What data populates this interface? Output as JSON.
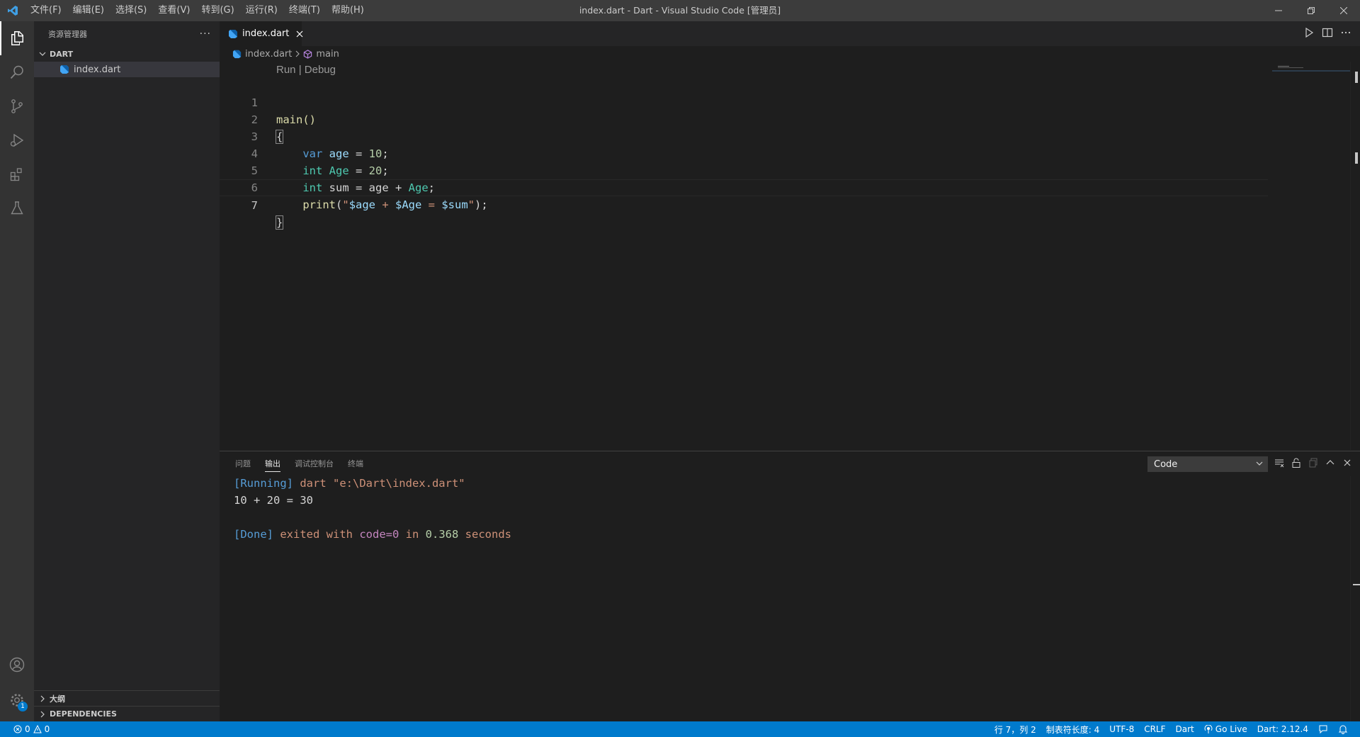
{
  "titlebar": {
    "title": "index.dart - Dart - Visual Studio Code [管理员]",
    "menu": [
      "文件(F)",
      "编辑(E)",
      "选择(S)",
      "查看(V)",
      "转到(G)",
      "运行(R)",
      "终端(T)",
      "帮助(H)"
    ]
  },
  "activity": {
    "badge": "1"
  },
  "sidebar": {
    "title": "资源管理器",
    "more": "···",
    "folder": "DART",
    "file": "index.dart",
    "outline": "大纲",
    "dependencies": "DEPENDENCIES"
  },
  "editor": {
    "tab_label": "index.dart",
    "breadcrumb_file": "index.dart",
    "breadcrumb_symbol": "main",
    "codelens_run": "Run",
    "codelens_sep": " | ",
    "codelens_debug": "Debug",
    "line_numbers": [
      "1",
      "2",
      "3",
      "4",
      "5",
      "6",
      "7"
    ],
    "code": {
      "l1_fn": "main()",
      "l2": "{",
      "l3_kw": "var",
      "l3_var": " age",
      "l3_op": " = ",
      "l3_num": "10",
      "l3_end": ";",
      "l4_type": "int",
      "l4_var": " Age",
      "l4_op": " = ",
      "l4_num": "20",
      "l4_end": ";",
      "l5_type": "int",
      "l5_var": " sum",
      "l5_op": " = age + ",
      "l5_var2": "Age",
      "l5_end": ";",
      "l6_fn": "print",
      "l6_open": "(",
      "l6_q1": "\"",
      "l6_i1": "$age",
      "l6_s1": " + ",
      "l6_i2": "$Age",
      "l6_s2": " = ",
      "l6_i3": "$sum",
      "l6_q2": "\"",
      "l6_close": ");",
      "l7": "}"
    }
  },
  "panel": {
    "tabs": [
      "问题",
      "输出",
      "调试控制台",
      "终端"
    ],
    "active_tab": "输出",
    "channel": "Code",
    "output": {
      "running": "[Running]",
      "cmd": " dart \"e:\\Dart\\index.dart\"",
      "result": "10 + 20 = 30",
      "done": "[Done]",
      "exited": " exited with ",
      "code": "code=0",
      "in": " in ",
      "secs": "0.368",
      "seconds": " seconds"
    }
  },
  "statusbar": {
    "errors": "0",
    "warnings": "0",
    "position": "行 7，列 2",
    "indent": "制表符长度: 4",
    "encoding": "UTF-8",
    "eol": "CRLF",
    "language": "Dart",
    "golive": "Go Live",
    "sdk": "Dart: 2.12.4"
  },
  "colors": {
    "accent": "#007acc",
    "keyword": "#569cd6",
    "type": "#4ec9b0",
    "string": "#ce9178",
    "number": "#b5cea8"
  }
}
